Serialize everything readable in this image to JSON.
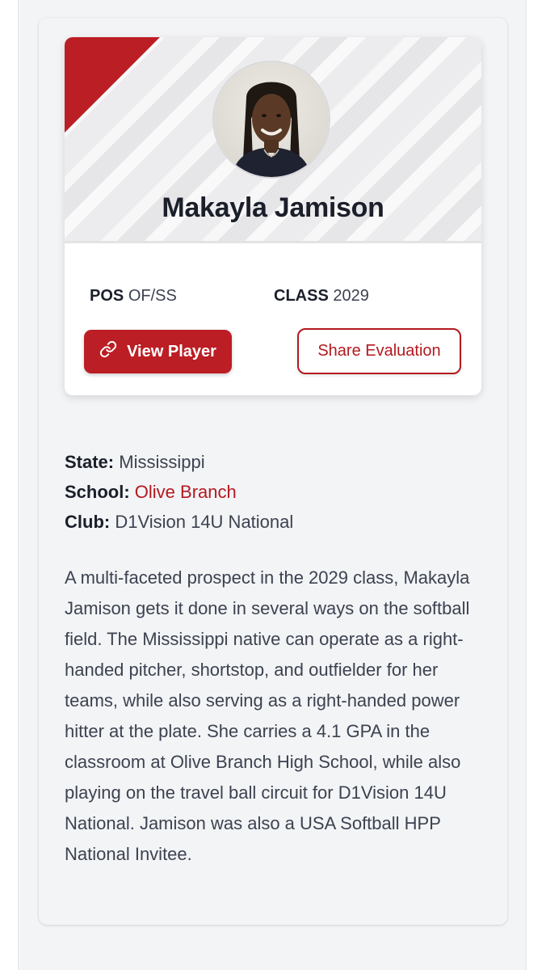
{
  "player": {
    "name": "Makayla Jamison",
    "pos_label": "POS",
    "pos_value": "OF/SS",
    "class_label": "CLASS",
    "class_value": "2029"
  },
  "actions": {
    "view_player": "View Player",
    "share_evaluation": "Share Evaluation"
  },
  "details": {
    "state_label": "State:",
    "state_value": "Mississippi",
    "school_label": "School:",
    "school_value": "Olive Branch",
    "club_label": "Club:",
    "club_value": "D1Vision 14U National"
  },
  "bio": "A multi-faceted prospect in the 2029 class, Makayla Jamison gets it done in several ways on the softball field. The Mississippi native can operate as a right-handed pitcher, shortstop, and outfielder for her teams, while also serving as a right-handed power hitter at the plate. She carries a 4.1 GPA in the classroom at Olive Branch High School, while also playing on the travel ball circuit for D1Vision 14U National. Jamison was also a USA Softball HPP National Invitee.",
  "colors": {
    "accent": "#bb1e24",
    "link": "#b3191f"
  },
  "icons": {
    "view_player": "link-icon"
  }
}
